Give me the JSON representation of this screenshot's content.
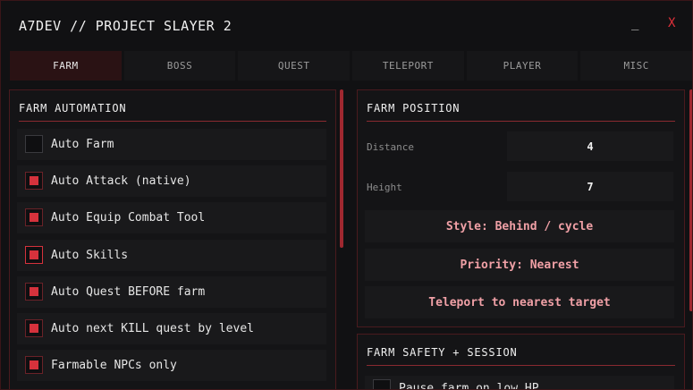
{
  "window": {
    "title": "A7DEV // PROJECT SLAYER 2",
    "minimize_label": "_",
    "close_label": "X"
  },
  "tabs": [
    {
      "label": "FARM",
      "active": true
    },
    {
      "label": "BOSS",
      "active": false
    },
    {
      "label": "QUEST",
      "active": false
    },
    {
      "label": "TELEPORT",
      "active": false
    },
    {
      "label": "PLAYER",
      "active": false
    },
    {
      "label": "MISC",
      "active": false
    }
  ],
  "farm_automation": {
    "title": "FARM AUTOMATION",
    "items": [
      {
        "label": "Auto Farm",
        "checked": false
      },
      {
        "label": "Auto Attack (native)",
        "checked": true
      },
      {
        "label": "Auto Equip Combat Tool",
        "checked": true
      },
      {
        "label": "Auto Skills",
        "checked": true
      },
      {
        "label": "Auto Quest BEFORE farm",
        "checked": true
      },
      {
        "label": "Auto next KILL quest by level",
        "checked": true
      },
      {
        "label": "Farmable NPCs only",
        "checked": true
      }
    ]
  },
  "farm_position": {
    "title": "FARM POSITION",
    "distance_label": "Distance",
    "distance_value": "4",
    "height_label": "Height",
    "height_value": "7",
    "style_button": "Style: Behind / cycle",
    "priority_button": "Priority: Nearest",
    "teleport_button": "Teleport to nearest target"
  },
  "farm_safety": {
    "title": "FARM SAFETY + SESSION",
    "items": [
      {
        "label": "Pause farm on low HP",
        "checked": false
      }
    ]
  },
  "colors": {
    "accent": "#d5323c",
    "border": "#4a1a1e",
    "background": "#111113"
  }
}
